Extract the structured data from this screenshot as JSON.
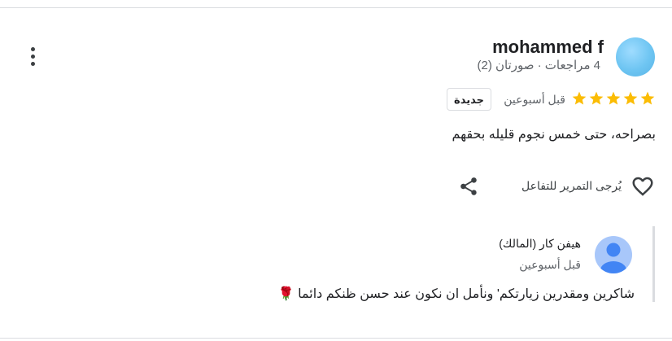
{
  "review": {
    "reviewer_name": "mohammed f",
    "reviewer_meta": "4 مراجعات · صورتان (2)",
    "rating": 5,
    "rating_max": 5,
    "time_ago": "قبل أسبوعين",
    "badge": "جديدة",
    "text": "بصراحه، حتى خمس نجوم قليله بحقهم"
  },
  "actions": {
    "like_label": "يُرجى التمرير للتفاعل"
  },
  "owner_reply": {
    "name": "هيفن كار (المالك)",
    "time_ago": "قبل أسبوعين",
    "text": "شاكرين ومقدرين زيارتكم' ونأمل ان نكون عند حسن ظنكم دائما 🌹"
  },
  "colors": {
    "star": "#fbbc04",
    "owner_avatar_bg": "#a8c7fa",
    "owner_avatar_fg": "#4285f4"
  },
  "icons": [
    "more-vert-icon",
    "star-icon",
    "heart-outline-icon",
    "share-icon",
    "person-icon"
  ]
}
